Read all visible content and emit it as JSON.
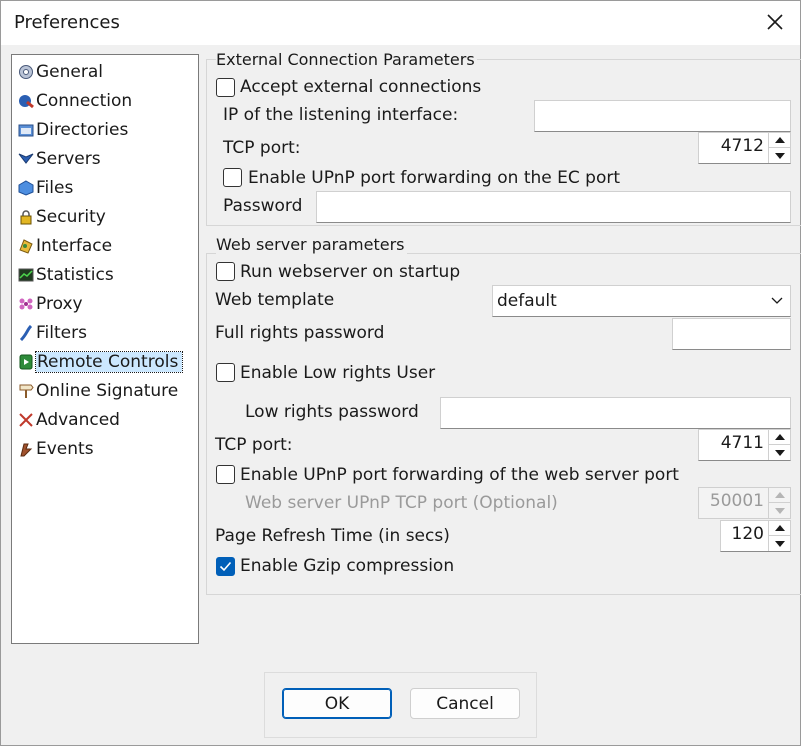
{
  "window": {
    "title": "Preferences",
    "close_icon": "close-icon"
  },
  "sidebar": {
    "items": [
      {
        "label": "General",
        "icon": "general-icon"
      },
      {
        "label": "Connection",
        "icon": "connection-icon"
      },
      {
        "label": "Directories",
        "icon": "directories-icon"
      },
      {
        "label": "Servers",
        "icon": "servers-icon"
      },
      {
        "label": "Files",
        "icon": "files-icon"
      },
      {
        "label": "Security",
        "icon": "lock-icon"
      },
      {
        "label": "Interface",
        "icon": "interface-icon"
      },
      {
        "label": "Statistics",
        "icon": "statistics-icon"
      },
      {
        "label": "Proxy",
        "icon": "proxy-icon"
      },
      {
        "label": "Filters",
        "icon": "filters-icon"
      },
      {
        "label": "Remote Controls",
        "icon": "remote-controls-icon",
        "selected": true
      },
      {
        "label": "Online Signature",
        "icon": "signpost-icon"
      },
      {
        "label": "Advanced",
        "icon": "advanced-icon"
      },
      {
        "label": "Events",
        "icon": "events-icon"
      }
    ]
  },
  "ec": {
    "group_title": "External Connection Parameters",
    "accept_label": "Accept external connections",
    "accept_checked": false,
    "ip_label": "IP of the listening interface:",
    "ip_value": "",
    "tcp_label": "TCP port:",
    "tcp_value": "4712",
    "upnp_label": "Enable UPnP port forwarding on the EC port",
    "upnp_checked": false,
    "password_label": "Password",
    "password_value": ""
  },
  "web": {
    "group_title": "Web server parameters",
    "run_label": "Run webserver on startup",
    "run_checked": false,
    "template_label": "Web template",
    "template_value": "default",
    "full_pw_label": "Full rights password",
    "full_pw_value": "",
    "low_user_label": "Enable Low rights User",
    "low_user_checked": false,
    "low_pw_label": "Low rights password",
    "low_pw_value": "",
    "tcp_label": "TCP port:",
    "tcp_value": "4711",
    "upnp_label": "Enable UPnP port forwarding of the web server port",
    "upnp_checked": false,
    "upnp_tcp_label": "Web server UPnP TCP port (Optional)",
    "upnp_tcp_value": "50001",
    "refresh_label": "Page Refresh Time (in secs)",
    "refresh_value": "120",
    "gzip_label": "Enable Gzip compression",
    "gzip_checked": true
  },
  "buttons": {
    "ok": "OK",
    "cancel": "Cancel"
  },
  "colors": {
    "accent": "#005fb8",
    "selection": "#cce8ff"
  }
}
